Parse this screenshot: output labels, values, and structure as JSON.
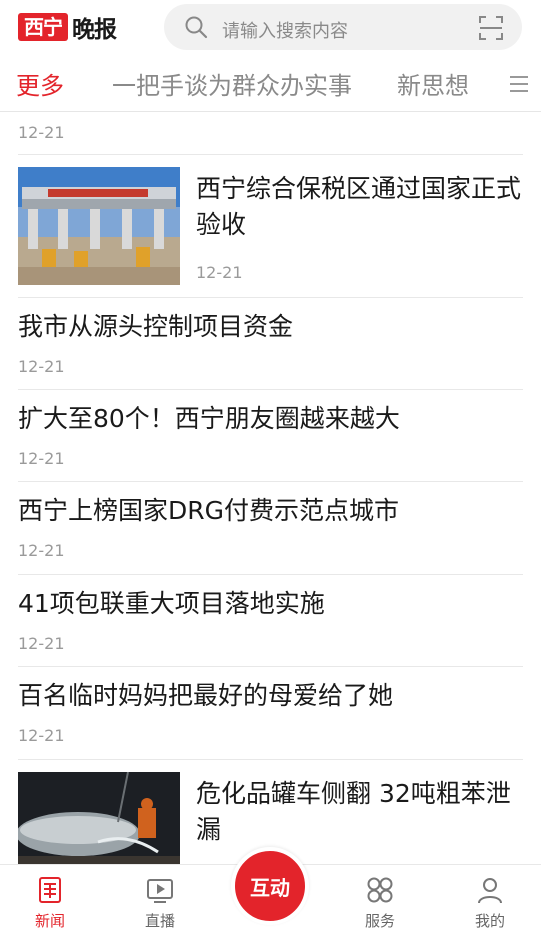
{
  "header": {
    "logo_box": "西宁",
    "logo_text": "晚报",
    "search_placeholder": "请输入搜索内容"
  },
  "tabs": [
    {
      "label": "更多",
      "active": true
    },
    {
      "label": "一把手谈为群众办实事",
      "active": false
    },
    {
      "label": "新思想",
      "active": false
    }
  ],
  "feed": {
    "top_date": "12-21",
    "items": [
      {
        "title": "西宁综合保税区通过国家正式验收",
        "date": "12-21",
        "thumb": "customs-gate-photo"
      },
      {
        "title": "我市从源头控制项目资金",
        "date": "12-21"
      },
      {
        "title": "扩大至80个！西宁朋友圈越来越大",
        "date": "12-21"
      },
      {
        "title": "西宁上榜国家DRG付费示范点城市",
        "date": "12-21"
      },
      {
        "title": "41项包联重大项目落地实施",
        "date": "12-21"
      },
      {
        "title": "百名临时妈妈把最好的母爱给了她",
        "date": "12-21"
      },
      {
        "title": "危化品罐车侧翻 32吨粗苯泄漏",
        "thumb": "rescue-scene-photo"
      }
    ]
  },
  "bottom_nav": [
    {
      "label": "新闻",
      "icon": "newspaper-icon",
      "active": true
    },
    {
      "label": "直播",
      "icon": "video-play-icon",
      "active": false
    },
    {
      "label": "互动",
      "icon": "center-button",
      "active": false
    },
    {
      "label": "服务",
      "icon": "grid-services-icon",
      "active": false
    },
    {
      "label": "我的",
      "icon": "user-icon",
      "active": false
    }
  ],
  "colors": {
    "accent": "#e3242b",
    "muted": "#8a8a8a",
    "divider": "#e8e8e8"
  }
}
